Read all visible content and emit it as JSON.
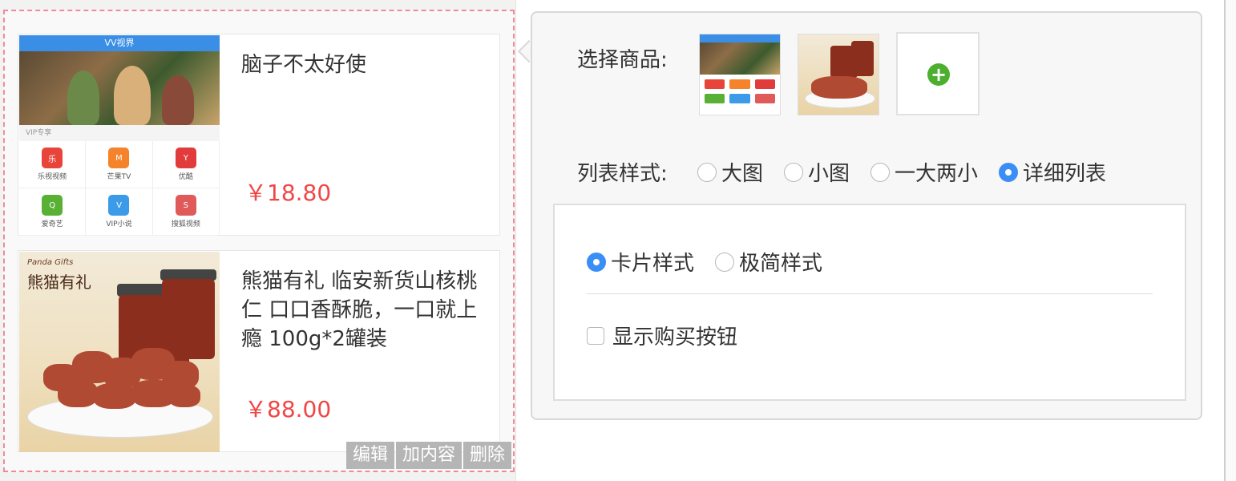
{
  "preview": {
    "cards": [
      {
        "title": "脑子不太好使",
        "price": "￥18.80",
        "image": {
          "top_bar": "VV视界",
          "section": "VIP专享",
          "apps": [
            "乐视视频",
            "芒果TV",
            "优酷",
            "爱奇艺",
            "VIP小说",
            "搜狐视频"
          ]
        }
      },
      {
        "title": "熊猫有礼 临安新货山核桃仁 口口香酥脆，一口就上瘾 100g*2罐装",
        "price": "￥88.00",
        "image": {
          "brand": "Panda Gifts",
          "title": "熊猫有礼"
        }
      }
    ],
    "actions": [
      "编辑",
      "加内容",
      "删除"
    ]
  },
  "config": {
    "select_goods_label": "选择商品:",
    "list_style_label": "列表样式:",
    "list_style_options": [
      {
        "label": "大图",
        "checked": false
      },
      {
        "label": "小图",
        "checked": false
      },
      {
        "label": "一大两小",
        "checked": false
      },
      {
        "label": "详细列表",
        "checked": true
      }
    ],
    "card_style_options": [
      {
        "label": "卡片样式",
        "checked": true
      },
      {
        "label": "极简样式",
        "checked": false
      }
    ],
    "show_buy_button": {
      "label": "显示购买按钮",
      "checked": false
    },
    "accent_color": "#3b8ef5",
    "price_color": "#f04646"
  }
}
